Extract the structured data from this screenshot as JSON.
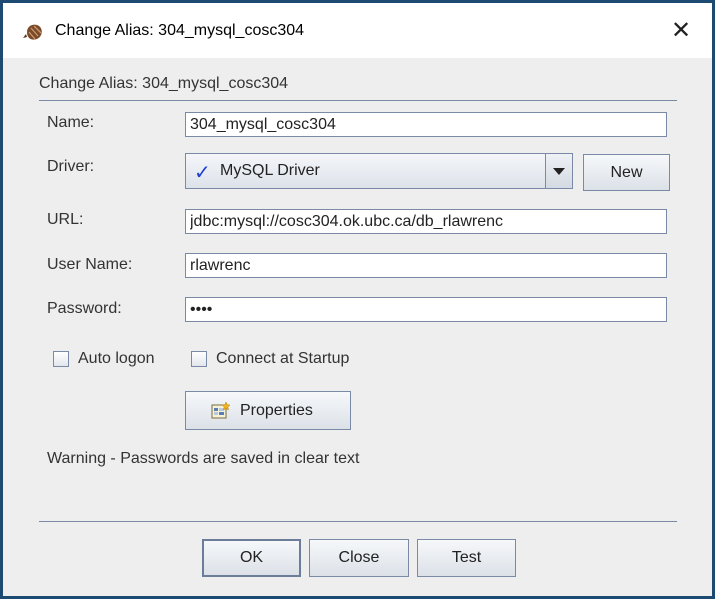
{
  "window": {
    "title": "Change Alias: 304_mysql_cosc304",
    "close_glyph": "✕",
    "icon": "db-alias-icon"
  },
  "header": {
    "label": "Change Alias: 304_mysql_cosc304"
  },
  "form": {
    "name": {
      "label": "Name:",
      "value": "304_mysql_cosc304"
    },
    "driver": {
      "label": "Driver:",
      "selected": "MySQL Driver",
      "check_glyph": "✓",
      "new_label": "New"
    },
    "url": {
      "label": "URL:",
      "value": "jdbc:mysql://cosc304.ok.ubc.ca/db_rlawrenc"
    },
    "username": {
      "label": "User Name:",
      "value": "rlawrenc"
    },
    "password": {
      "label": "Password:",
      "value": "abcd"
    }
  },
  "options": {
    "auto_logon": {
      "label": "Auto logon",
      "checked": false
    },
    "connect_at_startup": {
      "label": "Connect at Startup",
      "checked": false
    }
  },
  "properties_button": {
    "label": "Properties",
    "icon": "properties-icon"
  },
  "warning": "Warning - Passwords are saved in clear text",
  "footer": {
    "ok_label": "OK",
    "close_label": "Close",
    "test_label": "Test"
  },
  "colors": {
    "frame": "#1c4a72",
    "border": "#7a8aa6",
    "check": "#1f3fd1"
  }
}
